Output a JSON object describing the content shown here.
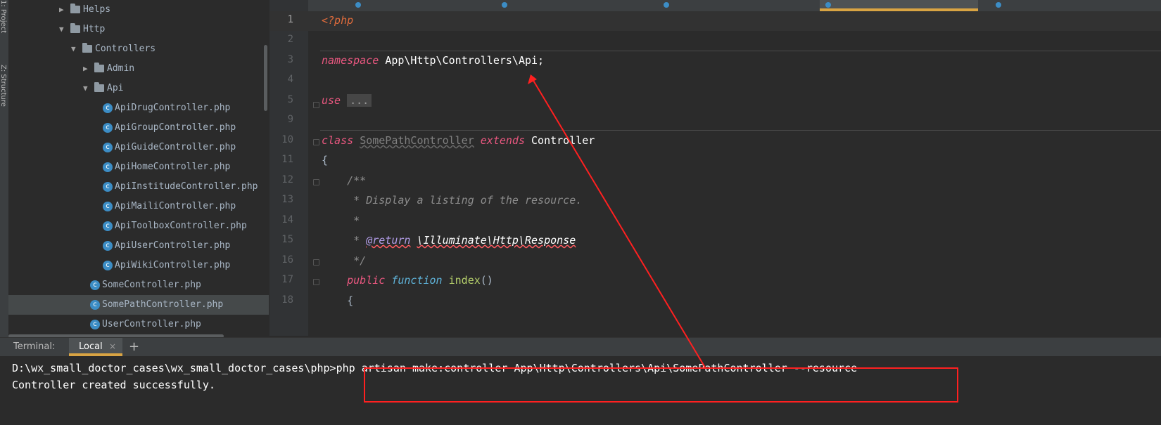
{
  "side_strip": {
    "project_label": "1: Project",
    "structure_label": "Z: Structure"
  },
  "project_tree": {
    "items": [
      {
        "label": "Helps",
        "type": "folder",
        "expanded": false,
        "depth": 1,
        "selected": false
      },
      {
        "label": "Http",
        "type": "folder",
        "expanded": true,
        "depth": 1,
        "selected": false
      },
      {
        "label": "Controllers",
        "type": "folder",
        "expanded": true,
        "depth": 2,
        "selected": false
      },
      {
        "label": "Admin",
        "type": "folder",
        "expanded": false,
        "depth": 3,
        "selected": false
      },
      {
        "label": "Api",
        "type": "folder",
        "expanded": true,
        "depth": 3,
        "selected": false
      },
      {
        "label": "ApiDrugController.php",
        "type": "file",
        "depth": 4,
        "selected": false
      },
      {
        "label": "ApiGroupController.php",
        "type": "file",
        "depth": 4,
        "selected": false
      },
      {
        "label": "ApiGuideController.php",
        "type": "file",
        "depth": 4,
        "selected": false
      },
      {
        "label": "ApiHomeController.php",
        "type": "file",
        "depth": 4,
        "selected": false
      },
      {
        "label": "ApiInstitudeController.php",
        "type": "file",
        "depth": 4,
        "selected": false
      },
      {
        "label": "ApiMailiController.php",
        "type": "file",
        "depth": 4,
        "selected": false
      },
      {
        "label": "ApiToolboxController.php",
        "type": "file",
        "depth": 4,
        "selected": false
      },
      {
        "label": "ApiUserController.php",
        "type": "file",
        "depth": 4,
        "selected": false
      },
      {
        "label": "ApiWikiController.php",
        "type": "file",
        "depth": 4,
        "selected": false
      },
      {
        "label": "SomeController.php",
        "type": "file",
        "depth": 3,
        "selected": false
      },
      {
        "label": "SomePathController.php",
        "type": "file",
        "depth": 3,
        "selected": true
      },
      {
        "label": "UserController.php",
        "type": "file",
        "depth": 3,
        "selected": false
      }
    ]
  },
  "editor": {
    "line_numbers": [
      "1",
      "2",
      "3",
      "4",
      "5",
      "9",
      "10",
      "11",
      "12",
      "13",
      "14",
      "15",
      "16",
      "17",
      "18"
    ],
    "current_line": "1",
    "code": {
      "php_open": "<?php",
      "namespace_kw": "namespace",
      "namespace_path": "App\\Http\\Controllers\\Api;",
      "use_kw": "use",
      "use_folded": "...",
      "class_kw": "class",
      "class_name": "SomePathController",
      "extends_kw": "extends",
      "parent_class": "Controller",
      "open_brace": "{",
      "doc_open": "/**",
      "doc_line1": " * Display a listing of the resource.",
      "doc_star": " *",
      "doc_star_prefix": " * ",
      "doc_return_tag": "@return",
      "doc_return_type": "\\Illuminate\\Http\\Response",
      "doc_close": " */",
      "public_kw": "public",
      "function_kw": "function",
      "method_name": "index",
      "method_parens": "()",
      "method_brace": "{"
    }
  },
  "terminal": {
    "label": "Terminal:",
    "tab_label": "Local",
    "close_glyph": "×",
    "add_glyph": "+",
    "prompt": "D:\\wx_small_doctor_cases\\wx_small_doctor_cases\\php>",
    "command": "php artisan make:controller App\\Http\\Controllers\\Api\\SomePathController --resource",
    "output": "Controller created successfully."
  },
  "annotation": {
    "box_color": "#ff2020",
    "arrow_color": "#ff2020"
  }
}
